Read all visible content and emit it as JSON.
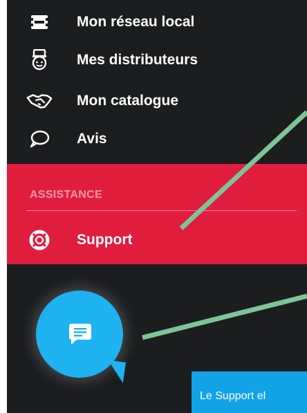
{
  "nav": {
    "items": [
      {
        "label": "Mon réseau local",
        "icon": "network-icon"
      },
      {
        "label": "Mes distributeurs",
        "icon": "distributor-icon"
      },
      {
        "label": "Mon catalogue",
        "icon": "handshake-icon"
      },
      {
        "label": "Avis",
        "icon": "speech-bubble-icon"
      }
    ]
  },
  "assistance": {
    "heading": "ASSISTANCE",
    "support_label": "Support",
    "support_icon": "lifebuoy-icon"
  },
  "chat": {
    "icon": "chat-icon"
  },
  "toast": {
    "text": "Le Support el"
  },
  "colors": {
    "sidebar_bg": "#1c1d1f",
    "assistance_bg": "#e11d3e",
    "chat_bubble": "#1fb2f0",
    "toast_bg": "#11a3e6",
    "annotation_arrow": "#7cc596"
  }
}
